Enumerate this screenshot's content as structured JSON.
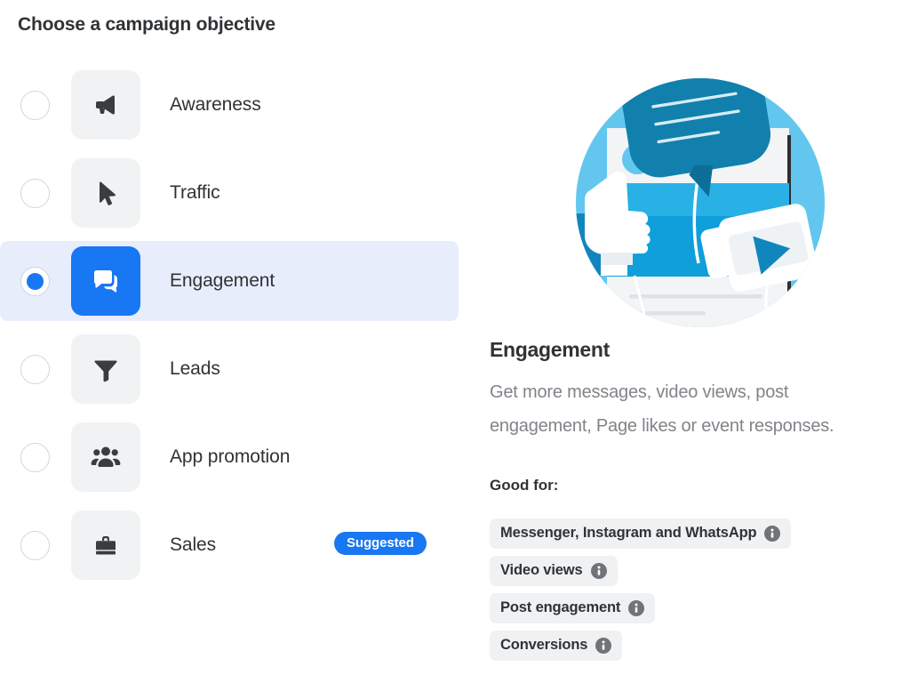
{
  "page_title": "Choose a campaign objective",
  "colors": {
    "accent_blue": "#1877f2",
    "selected_row_bg": "#e7edfb",
    "tile_bg": "#f1f2f3",
    "tag_bg": "#f0f1f2",
    "text_primary": "#303336",
    "text_secondary": "#808488",
    "illustration_circle": "#63c6ef",
    "illustration_bubble": "#1280ad"
  },
  "objectives": [
    {
      "label": "Awareness",
      "icon": "megaphone-icon",
      "selected": false,
      "badge": null
    },
    {
      "label": "Traffic",
      "icon": "cursor-icon",
      "selected": false,
      "badge": null
    },
    {
      "label": "Engagement",
      "icon": "chat-bubbles-icon",
      "selected": true,
      "badge": null
    },
    {
      "label": "Leads",
      "icon": "funnel-icon",
      "selected": false,
      "badge": null
    },
    {
      "label": "App promotion",
      "icon": "people-icon",
      "selected": false,
      "badge": null
    },
    {
      "label": "Sales",
      "icon": "shopping-bag-icon",
      "selected": false,
      "badge": "Suggested"
    }
  ],
  "detail": {
    "title": "Engagement",
    "description": "Get more messages, video views, post engagement, Page likes or event responses.",
    "good_for_label": "Good for:",
    "tags": [
      {
        "label": "Messenger, Instagram and WhatsApp",
        "icon": "info-icon"
      },
      {
        "label": "Video views",
        "icon": "info-icon"
      },
      {
        "label": "Post engagement",
        "icon": "info-icon"
      },
      {
        "label": "Conversions",
        "icon": "info-icon"
      }
    ],
    "illustration": "engagement-illustration"
  }
}
